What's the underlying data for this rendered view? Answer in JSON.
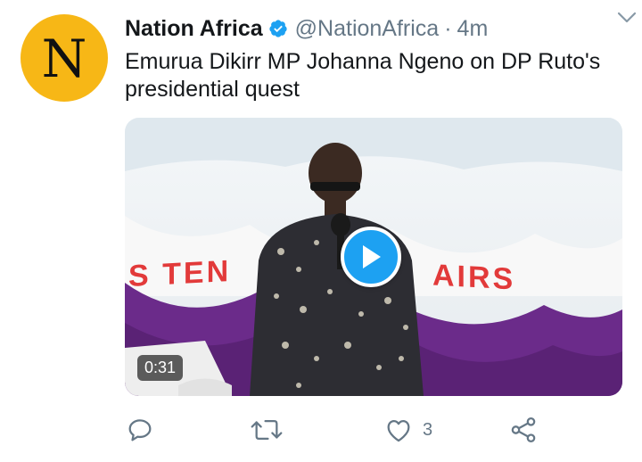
{
  "tweet": {
    "avatar_letter": "N",
    "display_name": "Nation Africa",
    "handle": "@NationAfrica",
    "separator": "·",
    "time": "4m",
    "text": "Emurua Dikirr MP Johanna Ngeno on DP Ruto's presidential quest",
    "video": {
      "duration": "0:31",
      "banner_text_left": "S TEN",
      "banner_text_right": "AIRS"
    },
    "actions": {
      "reply_count": "",
      "retweet_count": "",
      "like_count": "3"
    }
  },
  "colors": {
    "accent": "#1da1f2",
    "avatar_bg": "#f7b716",
    "secondary_text": "#657786",
    "banner_text": "#e23a3a",
    "purple_drape": "#6b2b8a"
  },
  "icons": [
    "verified-badge-icon",
    "chevron-down-icon",
    "play-icon",
    "reply-icon",
    "retweet-icon",
    "like-icon",
    "share-icon"
  ]
}
